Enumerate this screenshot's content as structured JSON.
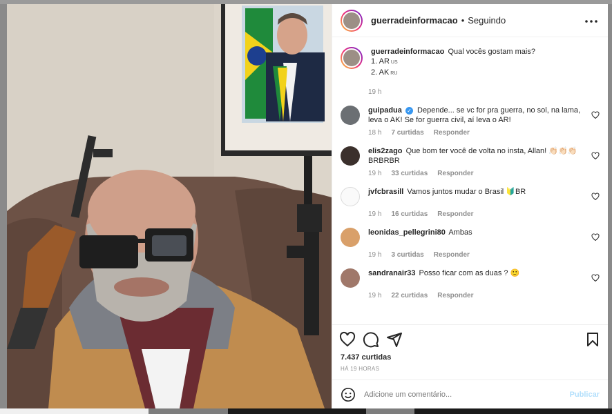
{
  "post": {
    "username": "guerradeinformacao",
    "follow_status": "Seguindo",
    "more_icon": "more-horizontal-icon"
  },
  "caption": {
    "username": "guerradeinformacao",
    "text": "Qual vocês gostam mais?",
    "line1": "1. AR",
    "line1_flag": "US",
    "line2": "2. AK",
    "line2_flag": "RU",
    "time": "19 h"
  },
  "comments": [
    {
      "username": "guipadua",
      "verified": true,
      "text": "Depende... se vc for pra guerra, no sol, na lama, leva o AK! Se for guerra civil, aí leva o AR!",
      "time": "18 h",
      "likes": "7 curtidas",
      "reply": "Responder"
    },
    {
      "username": "elis2zago",
      "verified": false,
      "text": "Que bom ter você de volta no insta, Allan! 👏🏻👏🏻👏🏻 BRBRBR",
      "time": "19 h",
      "likes": "33 curtidas",
      "reply": "Responder"
    },
    {
      "username": "jvfcbrasill",
      "verified": false,
      "text": "Vamos juntos mudar o Brasil 🔰BR",
      "time": "19 h",
      "likes": "16 curtidas",
      "reply": "Responder"
    },
    {
      "username": "leonidas_pellegrini80",
      "verified": false,
      "text": "Ambas",
      "time": "19 h",
      "likes": "3 curtidas",
      "reply": "Responder"
    },
    {
      "username": "sandranair33",
      "verified": false,
      "text": "Posso ficar com as duas ? 🙂",
      "time": "19 h",
      "likes": "22 curtidas",
      "reply": "Responder"
    }
  ],
  "stats": {
    "likes": "7.437 curtidas",
    "time": "HÁ 19 HORAS"
  },
  "add_comment": {
    "placeholder": "Adicione um comentário...",
    "publish": "Publicar"
  },
  "colors": {
    "text": "#262626",
    "secondary": "#8e8e8e",
    "verified": "#3897f0",
    "publish_disabled": "#b2dffc"
  }
}
